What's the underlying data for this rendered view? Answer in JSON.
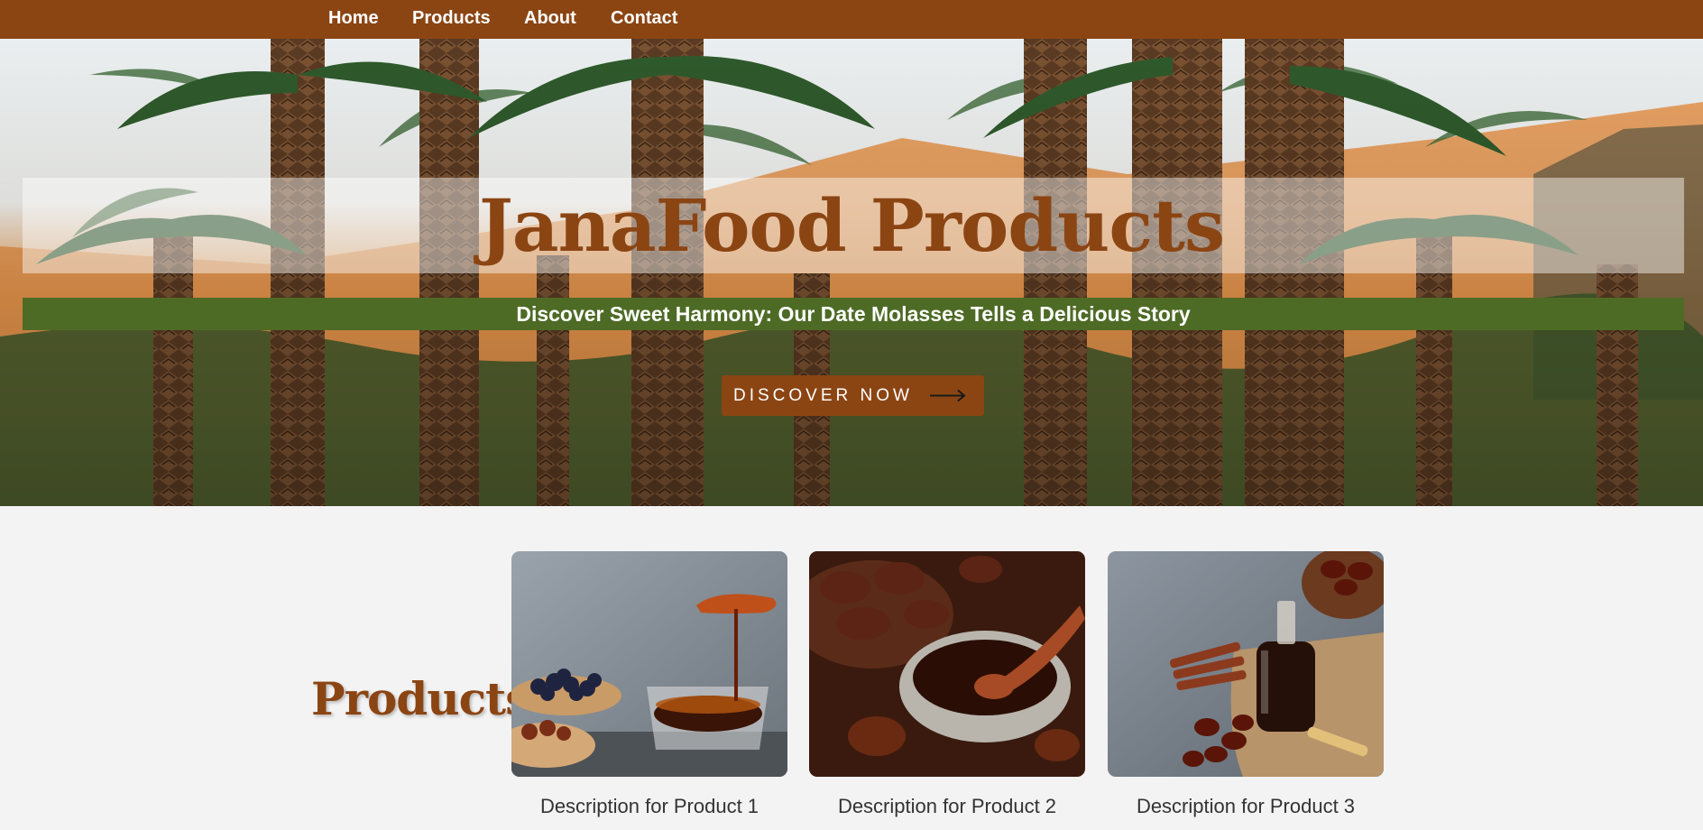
{
  "nav": {
    "items": [
      {
        "label": "Home"
      },
      {
        "label": "Products"
      },
      {
        "label": "About"
      },
      {
        "label": "Contact"
      }
    ]
  },
  "hero": {
    "title": "JanaFood Products",
    "subtitle": "Discover Sweet Harmony: Our Date Molasses Tells a Delicious Story",
    "cta_label": "DISCOVER NOW",
    "cta_icon": "long-arrow-right-icon"
  },
  "products": {
    "heading": "Products",
    "items": [
      {
        "description": "Description for Product 1",
        "image": "date-molasses-pouring-bowl-photo"
      },
      {
        "description": "Description for Product 2",
        "image": "date-molasses-wooden-spoon-photo"
      },
      {
        "description": "Description for Product 3",
        "image": "date-syrup-bottle-cinnamon-photo"
      }
    ]
  },
  "colors": {
    "brand_brown": "#8b4513",
    "subtitle_green": "#4e6b26",
    "page_background": "#f3f3f3"
  }
}
